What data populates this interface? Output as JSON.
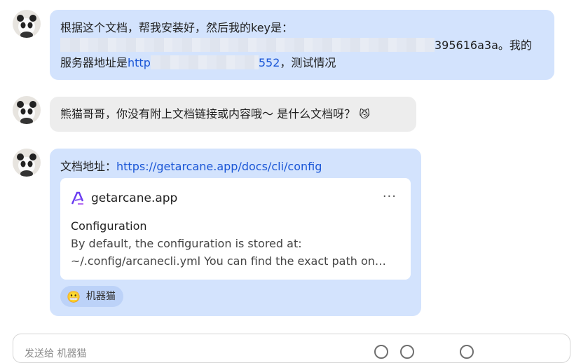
{
  "messages": [
    {
      "role": "user",
      "line1": "根据这个文档，帮我安装好，然后我的key是：",
      "line2_tail": "395616a3a。我的",
      "line3_prefix": "服务器地址是",
      "line3_url_start": "http",
      "line3_url_end": "552",
      "line3_suffix": "，测试情况"
    },
    {
      "role": "assistant",
      "text": "熊猫哥哥，你没有附上文档链接或内容哦～ 是什么文档呀？",
      "emoji": "😼"
    },
    {
      "role": "user",
      "label": "文档地址：",
      "url": "https://getarcane.app/docs/cli/config",
      "card": {
        "site": "getarcane.app",
        "more": "···",
        "title": "Configuration",
        "description": "By default, the configuration is stored at: ~/.config/arcanecli.yml You can find the exact path on your system by running arcane config path."
      },
      "chip": {
        "emoji": "😬",
        "label": "机器猫"
      }
    }
  ],
  "composer": {
    "placeholder": "发送给 机器猫"
  },
  "colors": {
    "user_bubble": "#d3e3fd",
    "bot_bubble": "#ededed",
    "link": "#1a56d6",
    "chip": "#bcd2f8"
  }
}
